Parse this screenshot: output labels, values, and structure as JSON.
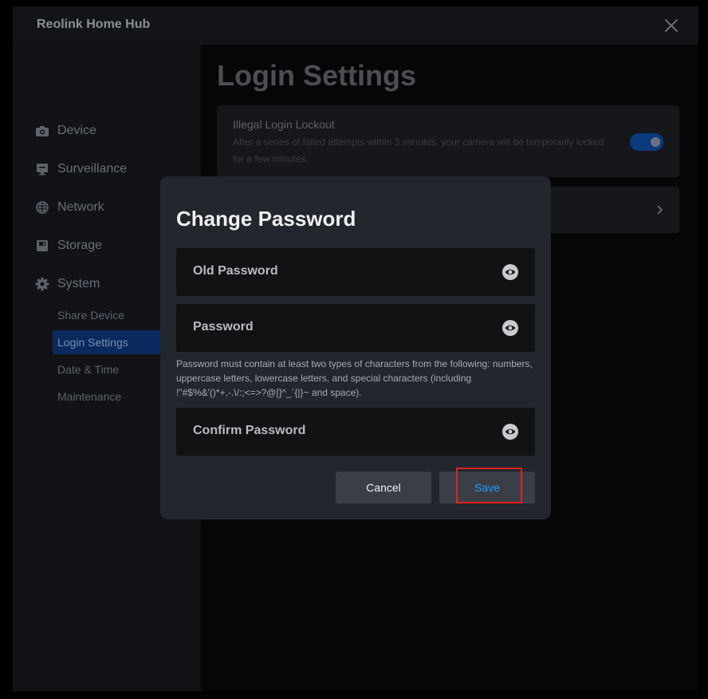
{
  "app": {
    "title": "Reolink Home Hub"
  },
  "sidebar": {
    "items": [
      {
        "label": "Device",
        "icon": "camera-icon"
      },
      {
        "label": "Surveillance",
        "icon": "monitor-icon"
      },
      {
        "label": "Network",
        "icon": "globe-icon"
      },
      {
        "label": "Storage",
        "icon": "storage-icon"
      },
      {
        "label": "System",
        "icon": "gear-icon"
      }
    ],
    "sub_items": [
      {
        "label": "Share Device",
        "active": false
      },
      {
        "label": "Login Settings",
        "active": true
      },
      {
        "label": "Date & Time",
        "active": false
      },
      {
        "label": "Maintenance",
        "active": false
      }
    ]
  },
  "main": {
    "page_title": "Login Settings",
    "lockout": {
      "title": "Illegal Login Lockout",
      "description": "After a series of failed attempts within 3 minutes, your camera will be temporarily locked for a few minutes.",
      "enabled": true
    }
  },
  "dialog": {
    "title": "Change Password",
    "fields": {
      "old_password": {
        "placeholder": "Old Password",
        "value": ""
      },
      "password": {
        "placeholder": "Password",
        "value": ""
      },
      "confirm_password": {
        "placeholder": "Confirm Password",
        "value": ""
      }
    },
    "hint": "Password must contain at least two types of characters from the following: numbers, uppercase letters, lowercase letters, and special characters (including !\"#$%&'()*+,-.\\/:;<=>?@[]^_`{|}~ and space).",
    "cancel_label": "Cancel",
    "save_label": "Save"
  },
  "colors": {
    "accent": "#1e9bff",
    "highlight": "#e0231c",
    "active_nav": "#0a2a5e"
  }
}
